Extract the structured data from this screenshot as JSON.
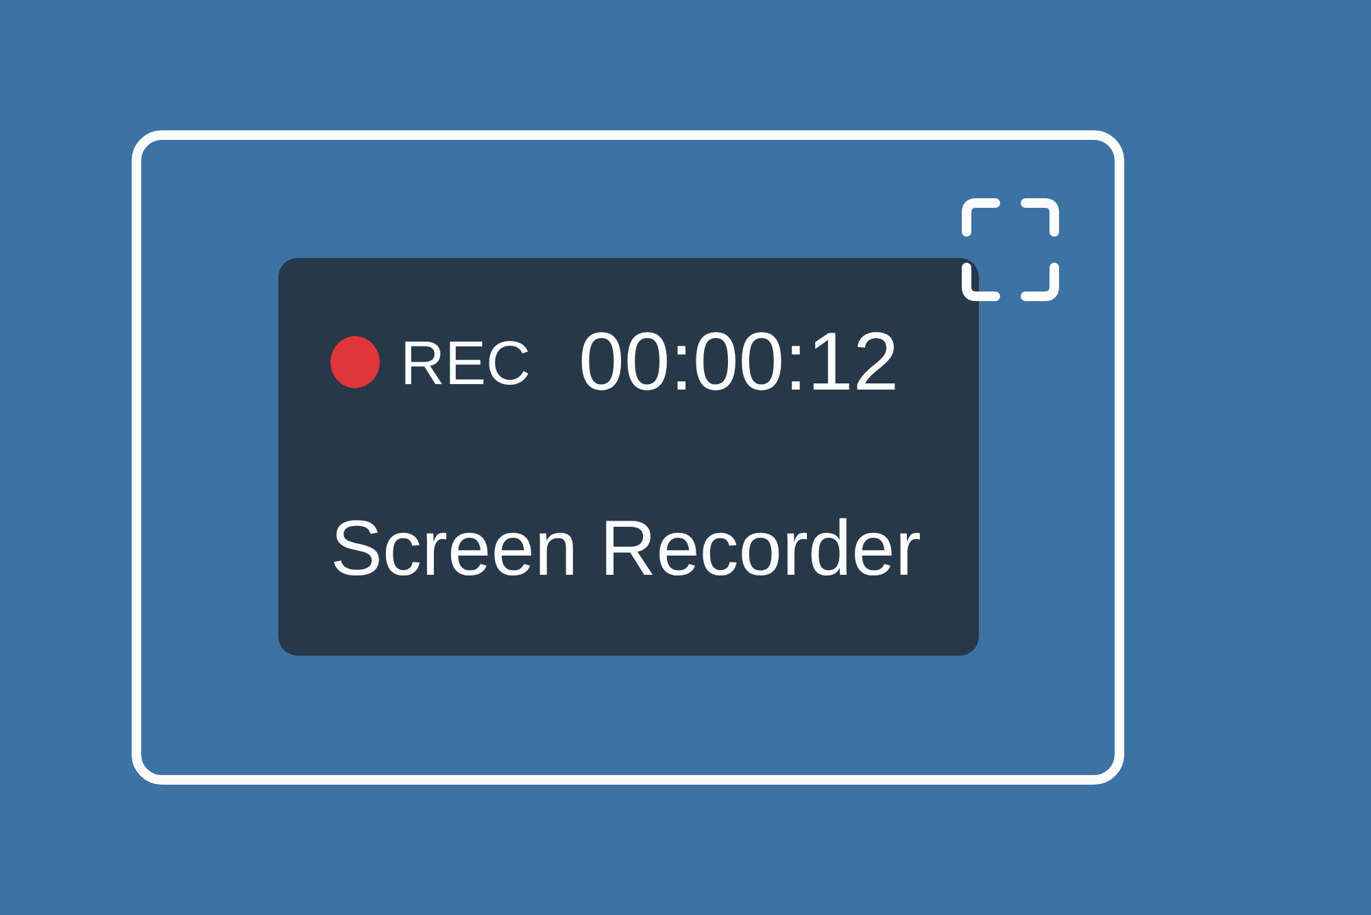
{
  "recorder": {
    "recording": true,
    "status_label": "REC",
    "elapsed_time": "00:00:12",
    "title": "Screen Recorder"
  }
}
